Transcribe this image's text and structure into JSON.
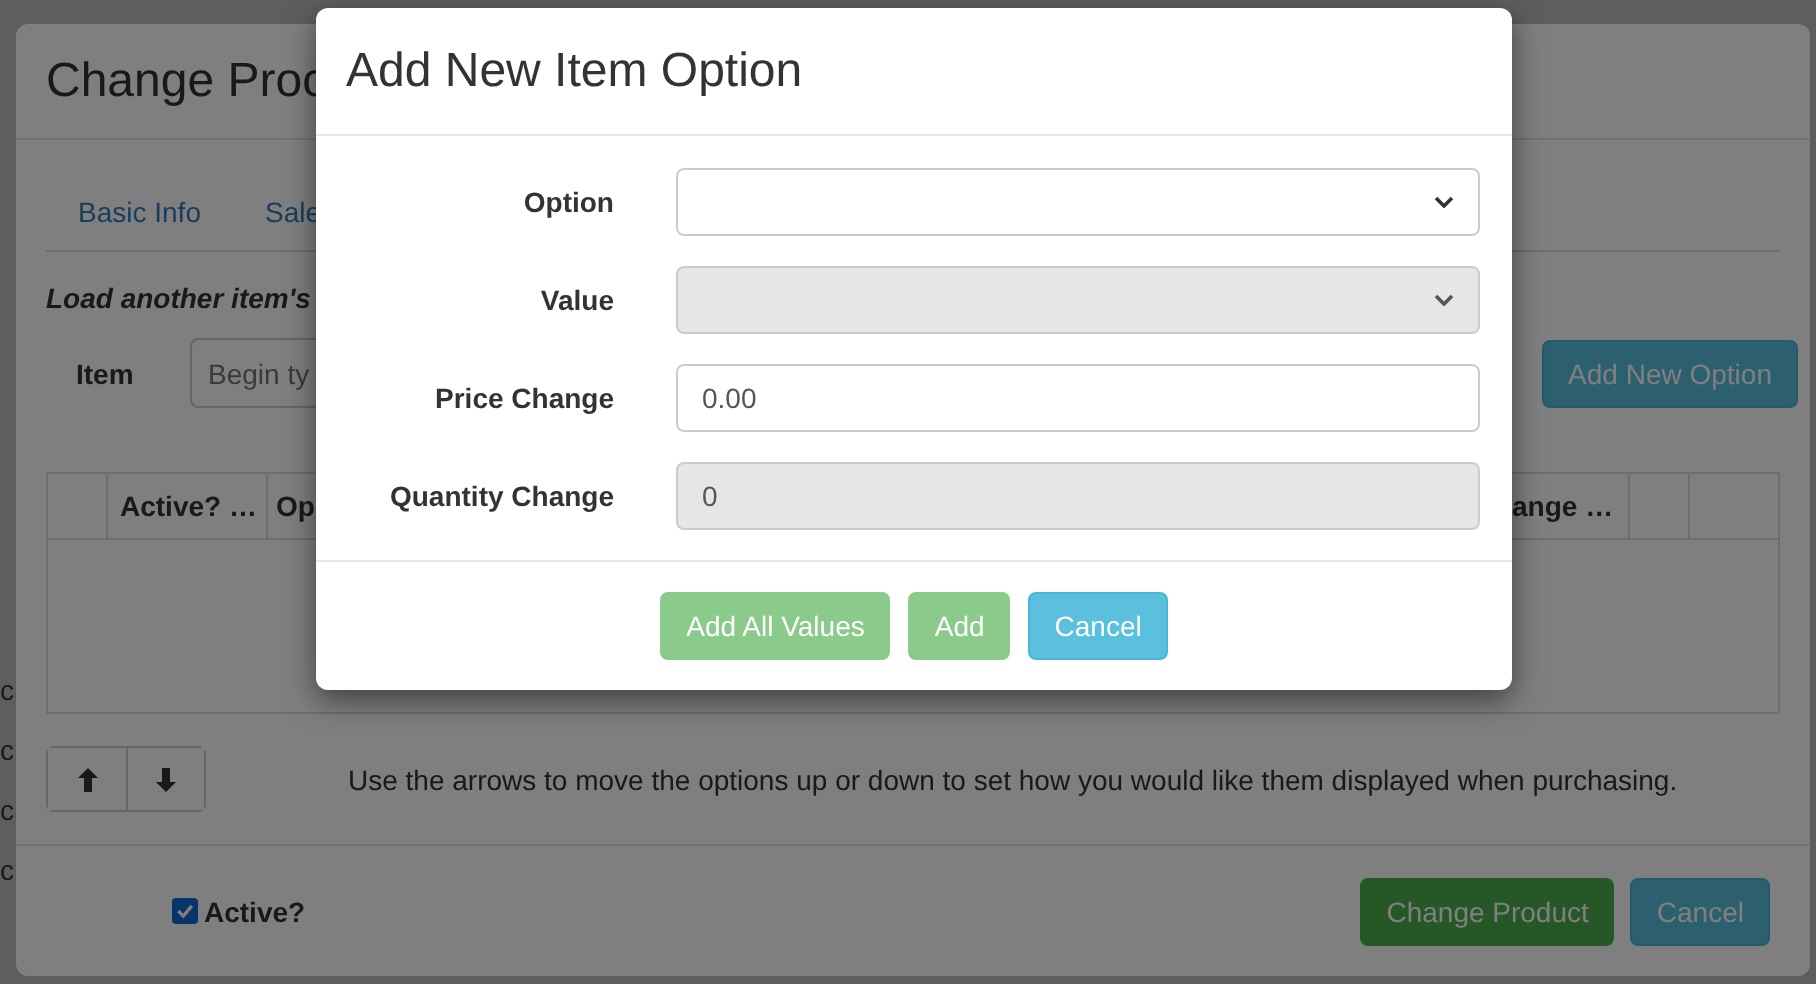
{
  "background_fragments": [
    "c",
    "c",
    "c",
    "c"
  ],
  "dialog": {
    "title": "Change Proc",
    "tabs": [
      {
        "label": "Basic Info",
        "selected": false
      },
      {
        "label": "Sale",
        "selected": false
      }
    ],
    "load_heading": "Load another item's",
    "item_label": "Item",
    "item_placeholder": "Begin ty",
    "add_option_button": "Add New Option",
    "table": {
      "columns": [
        {
          "label": "Active? …"
        },
        {
          "label": "Op"
        },
        {
          "label": "ange …"
        }
      ]
    },
    "help_text": "Use the arrows to move the options up or down to set how you would like them displayed when purchasing.",
    "active_checkbox": {
      "label": "Active?",
      "checked": true
    },
    "footer_buttons": [
      {
        "label": "Change Product",
        "kind": "success"
      },
      {
        "label": "Cancel",
        "kind": "info"
      }
    ]
  },
  "popup": {
    "title": "Add New Item Option",
    "fields": [
      {
        "label": "Option",
        "kind": "select",
        "disabled": false
      },
      {
        "label": "Value",
        "kind": "select",
        "disabled": true
      },
      {
        "label": "Price Change",
        "kind": "text",
        "value": "0.00",
        "disabled": false
      },
      {
        "label": "Quantity Change",
        "kind": "text",
        "value": "0",
        "disabled": true
      }
    ],
    "buttons": [
      {
        "label": "Add All Values",
        "kind": "success",
        "disabled": true
      },
      {
        "label": "Add",
        "kind": "success",
        "disabled": true
      },
      {
        "label": "Cancel",
        "kind": "info",
        "disabled": false
      }
    ]
  }
}
